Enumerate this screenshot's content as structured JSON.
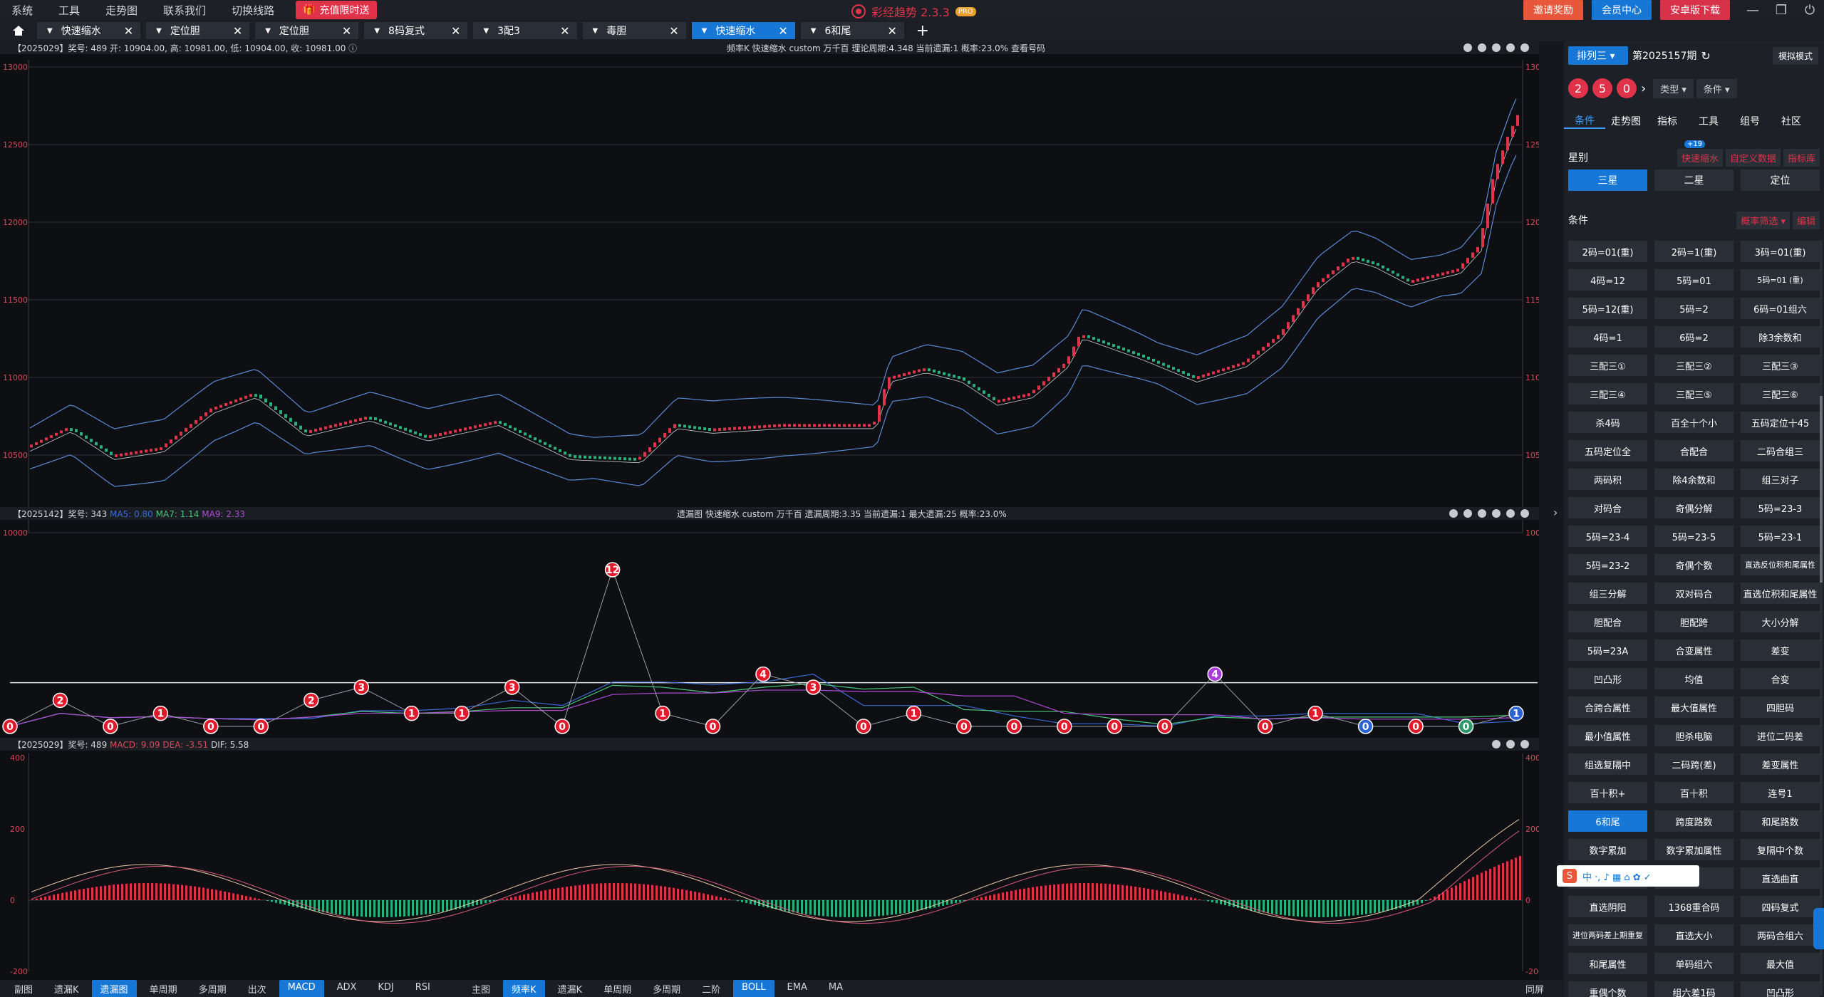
{
  "menu": {
    "items": [
      "系统",
      "工具",
      "走势图",
      "联系我们",
      "切换线路"
    ],
    "promo": "充值限时送"
  },
  "logo": {
    "title": "彩经趋势 2.3.3",
    "badge": "PRO"
  },
  "top_buttons": {
    "invite": "邀请奖励",
    "member": "会员中心",
    "download": "安卓版下载"
  },
  "window_controls": {
    "minimize": "—",
    "restore": "❐",
    "close": "⏻"
  },
  "tabs": [
    {
      "label": "快速缩水",
      "active": false
    },
    {
      "label": "定位胆",
      "active": false
    },
    {
      "label": "定位胆",
      "active": false
    },
    {
      "label": "8码复式",
      "active": false
    },
    {
      "label": "3配3",
      "active": false
    },
    {
      "label": "毒胆",
      "active": false
    },
    {
      "label": "快速缩水",
      "active": true
    },
    {
      "label": "6和尾",
      "active": false
    }
  ],
  "tab_add": "+",
  "panes": {
    "k": {
      "left": "【2025029】奖号: 489  开: 10904.00, 高: 10981.00, 低: 10904.00, 收: 10981.00 ⓘ",
      "center": "频率K  快速缩水  custom  万千百  理论周期:4.348  当前遗漏:1  概率:23.0%       查看号码"
    },
    "omit": {
      "left": "【2025142】奖号: 343",
      "ma5": "MA5: 0.80",
      "ma7": "MA7: 1.14",
      "ma9": "MA9: 2.33",
      "center": "遗漏图  快速缩水  custom  万千百  遗漏周期:3.35  当前遗漏:1  最大遗漏:25  概率:23.0%"
    },
    "macd": {
      "left": "【2025029】奖号: 489",
      "macd": "MACD: 9.09",
      "dea": "DEA: -3.51",
      "dif": "DIF: 5.58"
    }
  },
  "chart_data": [
    {
      "type": "candlestick",
      "title": "频率K",
      "ylim": [
        10000,
        13000
      ],
      "yticks": [
        10000,
        10500,
        11000,
        11500,
        12000,
        12500,
        13000
      ],
      "indicator": "BOLL",
      "last": {
        "open": 10904.0,
        "high": 10981.0,
        "low": 10904.0,
        "close": 10981.0
      }
    },
    {
      "type": "line",
      "title": "遗漏图",
      "x": [
        0,
        1,
        2,
        3,
        4,
        5,
        6,
        7,
        8,
        9,
        10,
        11,
        12,
        13,
        14,
        15,
        16,
        17,
        18,
        19,
        20,
        21,
        22,
        23,
        24,
        25,
        26,
        27,
        28,
        29,
        30
      ],
      "values": [
        0,
        2,
        0,
        1,
        0,
        0,
        2,
        3,
        1,
        1,
        3,
        0,
        12,
        1,
        0,
        4,
        3,
        0,
        1,
        0,
        0,
        0,
        0,
        0,
        4,
        0,
        1,
        0,
        0,
        0,
        1
      ],
      "highlight": {
        "24": "purple",
        "29": "green",
        "27": "blue",
        "30": "blue"
      },
      "threshold": 3.35,
      "ma": [
        "MA5",
        "MA7",
        "MA9"
      ]
    },
    {
      "type": "bar",
      "title": "MACD",
      "ylim": [
        -200,
        400
      ],
      "yticks": [
        -200,
        0,
        200,
        400
      ],
      "series": [
        "MACD",
        "DEA",
        "DIF"
      ]
    }
  ],
  "bottom": {
    "left": [
      "副图",
      "遗漏K",
      "遗漏图",
      "单周期",
      "多周期",
      "出次",
      "MACD",
      "ADX",
      "KDJ",
      "RSI"
    ],
    "left_on": [
      "遗漏图",
      "MACD"
    ],
    "right": [
      "主图",
      "频率K",
      "遗漏K",
      "单周期",
      "多周期",
      "二阶",
      "BOLL",
      "EMA",
      "MA"
    ],
    "right_on": [
      "频率K",
      "BOLL"
    ],
    "fullscreen": "同屏"
  },
  "right": {
    "lottery": "排列三 ▾",
    "period": "第2025157期",
    "sim": "模拟模式",
    "balls": [
      "2",
      "5",
      "0"
    ],
    "arrow": "›",
    "type_sel": "类型 ▾",
    "cond_sel": "条件 ▾",
    "tabs": [
      "条件",
      "走势图",
      "指标",
      "工具",
      "组号",
      "社区"
    ],
    "star_label": "星别",
    "quick": "快速缩水",
    "quick_badge": "+19",
    "custom": "自定义数据",
    "indlib": "指标库",
    "levels": [
      "三星",
      "二星",
      "定位"
    ],
    "cond_label": "条件",
    "prob_filter": "概率筛选 ▾",
    "edit": "编辑",
    "cells": [
      "2码=01(重)",
      "2码=1(重)",
      "3码=01(重)",
      "4码=12",
      "5码=01",
      "5码=01 (重)",
      "5码=12(重)",
      "5码=2",
      "6码=01组六",
      "4码=1",
      "6码=2",
      "除3余数和",
      "三配三①",
      "三配三②",
      "三配三③",
      "三配三④",
      "三配三⑤",
      "三配三⑥",
      "杀4码",
      "百全十个小",
      "五码定位十45",
      "五码定位全",
      "合配合",
      "二码合组三",
      "两码积",
      "除4余数和",
      "组三对子",
      "对码合",
      "奇偶分解",
      "5码=23-3",
      "5码=23-4",
      "5码=23-5",
      "5码=23-1",
      "5码=23-2",
      "奇偶个数",
      "直选反位积和尾属性",
      "组三分解",
      "双对码合",
      "直选位积和尾属性",
      "胆配合",
      "胆配跨",
      "大小分解",
      "5码=23A",
      "合变属性",
      "差变",
      "凹凸形",
      "均值",
      "合变",
      "合跨合属性",
      "最大值属性",
      "四胆码",
      "最小值属性",
      "胆杀电脑",
      "进位二码差",
      "组选复隔中",
      "二码跨(差)",
      "差变属性",
      "百十积+",
      "百十积",
      "连号1",
      "6和尾",
      "跨度路数",
      "和尾路数",
      "数字累加",
      "数字累加属性",
      "复隔中个数",
      "",
      "",
      "直选曲直",
      "直选阴阳",
      "1368重合码",
      "四码复式",
      "进位两码差上期重复",
      "直选大小",
      "两码合组六",
      "和尾属性",
      "单码组六",
      "最大值",
      "重偶个数",
      "组六差1码",
      "凹凸形"
    ],
    "active_cell": "6和尾",
    "ime": {
      "logo": "S",
      "text": "中 ·, ♪ ▦ ⌂ ✿ ✓"
    }
  }
}
